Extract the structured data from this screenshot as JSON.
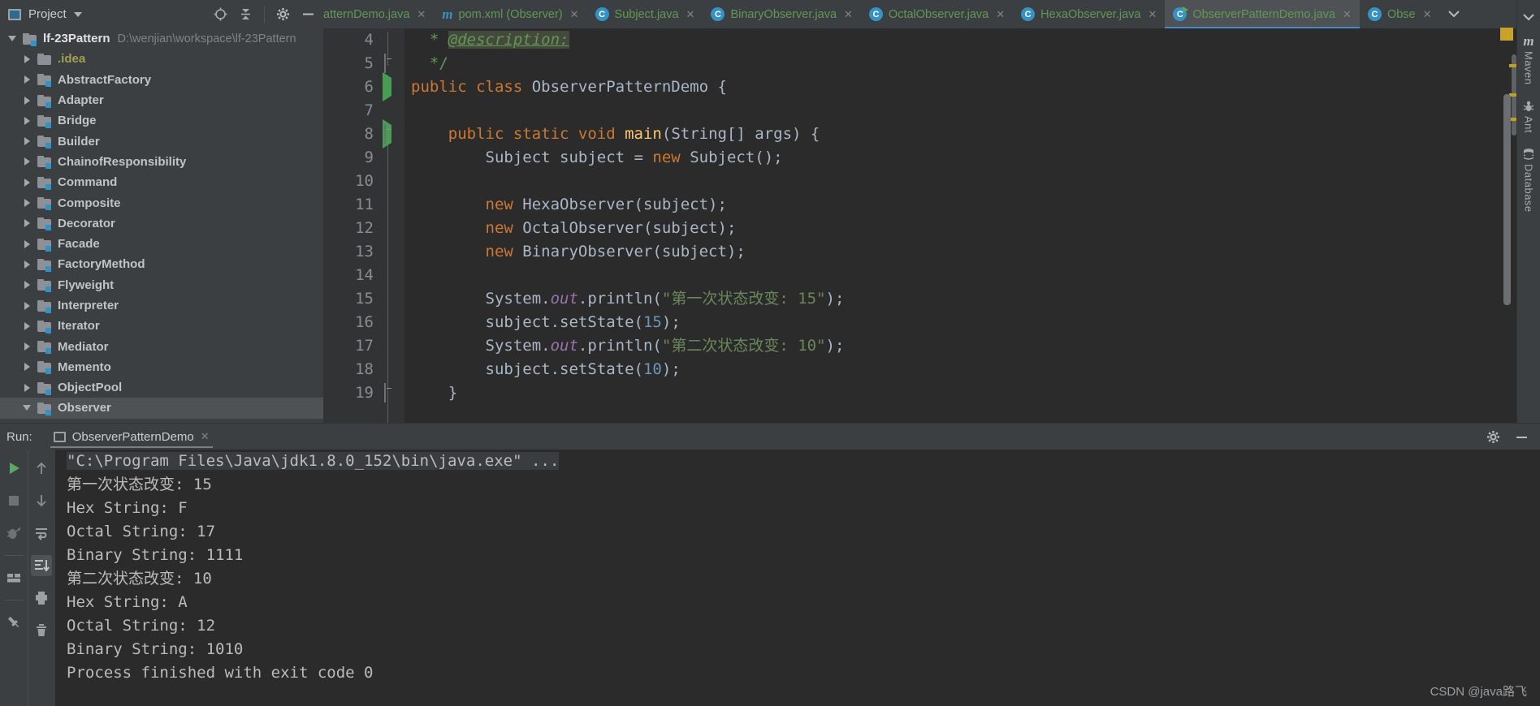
{
  "project_panel": {
    "title": "Project",
    "icons": [
      "locate-icon",
      "collapse-all-icon",
      "settings-icon",
      "hide-icon"
    ],
    "tree": [
      {
        "label": "lf-23Pattern",
        "path": "D:\\wenjian\\workspace\\lf-23Pattern",
        "expanded": true,
        "depth": 0,
        "kind": "root"
      },
      {
        "label": ".idea",
        "path": "",
        "expanded": false,
        "depth": 1,
        "kind": "idea"
      },
      {
        "label": "AbstractFactory",
        "path": "",
        "expanded": false,
        "depth": 1,
        "kind": "module"
      },
      {
        "label": "Adapter",
        "path": "",
        "expanded": false,
        "depth": 1,
        "kind": "module"
      },
      {
        "label": "Bridge",
        "path": "",
        "expanded": false,
        "depth": 1,
        "kind": "module"
      },
      {
        "label": "Builder",
        "path": "",
        "expanded": false,
        "depth": 1,
        "kind": "module"
      },
      {
        "label": "ChainofResponsibility",
        "path": "",
        "expanded": false,
        "depth": 1,
        "kind": "module"
      },
      {
        "label": "Command",
        "path": "",
        "expanded": false,
        "depth": 1,
        "kind": "module"
      },
      {
        "label": "Composite",
        "path": "",
        "expanded": false,
        "depth": 1,
        "kind": "module"
      },
      {
        "label": "Decorator",
        "path": "",
        "expanded": false,
        "depth": 1,
        "kind": "module"
      },
      {
        "label": "Facade",
        "path": "",
        "expanded": false,
        "depth": 1,
        "kind": "module"
      },
      {
        "label": "FactoryMethod",
        "path": "",
        "expanded": false,
        "depth": 1,
        "kind": "module"
      },
      {
        "label": "Flyweight",
        "path": "",
        "expanded": false,
        "depth": 1,
        "kind": "module"
      },
      {
        "label": "Interpreter",
        "path": "",
        "expanded": false,
        "depth": 1,
        "kind": "module"
      },
      {
        "label": "Iterator",
        "path": "",
        "expanded": false,
        "depth": 1,
        "kind": "module"
      },
      {
        "label": "Mediator",
        "path": "",
        "expanded": false,
        "depth": 1,
        "kind": "module"
      },
      {
        "label": "Memento",
        "path": "",
        "expanded": false,
        "depth": 1,
        "kind": "module"
      },
      {
        "label": "ObjectPool",
        "path": "",
        "expanded": false,
        "depth": 1,
        "kind": "module"
      },
      {
        "label": "Observer",
        "path": "",
        "expanded": true,
        "depth": 1,
        "kind": "module",
        "selected": true
      }
    ]
  },
  "editor_tabs": [
    {
      "label": "atternDemo.java",
      "icon": "class-icon",
      "truncated": true,
      "active": false
    },
    {
      "label": "pom.xml (Observer)",
      "icon": "maven-icon",
      "truncated": false,
      "active": false
    },
    {
      "label": "Subject.java",
      "icon": "class-icon",
      "truncated": false,
      "active": false
    },
    {
      "label": "BinaryObserver.java",
      "icon": "class-icon",
      "truncated": false,
      "active": false
    },
    {
      "label": "OctalObserver.java",
      "icon": "class-icon",
      "truncated": false,
      "active": false
    },
    {
      "label": "HexaObserver.java",
      "icon": "class-icon",
      "truncated": false,
      "active": false
    },
    {
      "label": "ObserverPatternDemo.java",
      "icon": "runnable-class-icon",
      "truncated": false,
      "active": true
    },
    {
      "label": "Obse",
      "icon": "class-icon",
      "truncated": false,
      "active": false
    }
  ],
  "editor": {
    "first_line_number": 4,
    "lines": [
      {
        "n": 4,
        "gutter": "",
        "fold": false,
        "tokens": [
          {
            "t": "  ",
            "c": "plain"
          },
          {
            "t": "* ",
            "c": "cmt"
          },
          {
            "t": "@description:",
            "c": "cmt-tag"
          }
        ]
      },
      {
        "n": 5,
        "gutter": "",
        "fold": true,
        "tokens": [
          {
            "t": "  ",
            "c": "plain"
          },
          {
            "t": "*/",
            "c": "cmt"
          }
        ]
      },
      {
        "n": 6,
        "gutter": "run",
        "fold": false,
        "tokens": [
          {
            "t": "public class ",
            "c": "kw"
          },
          {
            "t": "ObserverPatternDemo {",
            "c": "cls"
          }
        ]
      },
      {
        "n": 7,
        "gutter": "",
        "fold": false,
        "tokens": []
      },
      {
        "n": 8,
        "gutter": "run",
        "fold": true,
        "tokens": [
          {
            "t": "    ",
            "c": "plain"
          },
          {
            "t": "public static void ",
            "c": "kw"
          },
          {
            "t": "main",
            "c": "meth"
          },
          {
            "t": "(String[] args) {",
            "c": "cls"
          }
        ]
      },
      {
        "n": 9,
        "gutter": "",
        "fold": false,
        "tokens": [
          {
            "t": "        Subject subject = ",
            "c": "cls"
          },
          {
            "t": "new ",
            "c": "kw"
          },
          {
            "t": "Subject();",
            "c": "cls"
          }
        ]
      },
      {
        "n": 10,
        "gutter": "",
        "fold": false,
        "tokens": []
      },
      {
        "n": 11,
        "gutter": "",
        "fold": false,
        "tokens": [
          {
            "t": "        ",
            "c": "plain"
          },
          {
            "t": "new ",
            "c": "kw"
          },
          {
            "t": "HexaObserver(subject)",
            "c": "cls"
          },
          {
            "t": ";",
            "c": "cls"
          }
        ]
      },
      {
        "n": 12,
        "gutter": "",
        "fold": false,
        "tokens": [
          {
            "t": "        ",
            "c": "plain"
          },
          {
            "t": "new ",
            "c": "kw"
          },
          {
            "t": "OctalObserver(subject)",
            "c": "cls"
          },
          {
            "t": ";",
            "c": "cls"
          }
        ]
      },
      {
        "n": 13,
        "gutter": "",
        "fold": false,
        "tokens": [
          {
            "t": "        ",
            "c": "plain"
          },
          {
            "t": "new ",
            "c": "kw"
          },
          {
            "t": "BinaryObserver(subject)",
            "c": "cls"
          },
          {
            "t": ";",
            "c": "cls"
          }
        ]
      },
      {
        "n": 14,
        "gutter": "",
        "fold": false,
        "tokens": []
      },
      {
        "n": 15,
        "gutter": "",
        "fold": false,
        "tokens": [
          {
            "t": "        System.",
            "c": "cls"
          },
          {
            "t": "out",
            "c": "fld"
          },
          {
            "t": ".println(",
            "c": "cls"
          },
          {
            "t": "\"第一次状态改变: 15\"",
            "c": "str"
          },
          {
            "t": ");",
            "c": "cls"
          }
        ]
      },
      {
        "n": 16,
        "gutter": "",
        "fold": false,
        "tokens": [
          {
            "t": "        subject.setState(",
            "c": "cls"
          },
          {
            "t": "15",
            "c": "num"
          },
          {
            "t": ");",
            "c": "cls"
          }
        ]
      },
      {
        "n": 17,
        "gutter": "",
        "fold": false,
        "tokens": [
          {
            "t": "        System.",
            "c": "cls"
          },
          {
            "t": "out",
            "c": "fld"
          },
          {
            "t": ".println(",
            "c": "cls"
          },
          {
            "t": "\"第二次状态改变: 10\"",
            "c": "str"
          },
          {
            "t": ");",
            "c": "cls"
          }
        ]
      },
      {
        "n": 18,
        "gutter": "",
        "fold": false,
        "tokens": [
          {
            "t": "        subject.setState(",
            "c": "cls"
          },
          {
            "t": "10",
            "c": "num"
          },
          {
            "t": ");",
            "c": "cls"
          }
        ]
      },
      {
        "n": 19,
        "gutter": "",
        "fold": true,
        "tokens": [
          {
            "t": "    }",
            "c": "cls"
          }
        ]
      }
    ]
  },
  "right_stripe": [
    {
      "label": "Maven",
      "icon": "maven-icon"
    },
    {
      "label": "Ant",
      "icon": "ant-icon"
    },
    {
      "label": "Database",
      "icon": "database-icon"
    }
  ],
  "run_panel": {
    "title": "Run:",
    "tab_name": "ObserverPatternDemo",
    "toolbar_left": [
      "rerun-icon",
      "stop-icon",
      "debug-icon",
      "layout-icon",
      "pin-icon"
    ],
    "toolbar_right": [
      "up-arrow-icon",
      "down-arrow-icon",
      "soft-wrap-icon",
      "scroll-to-end-icon",
      "print-icon",
      "trash-icon"
    ],
    "header_right": [
      "settings-icon",
      "minimize-icon"
    ],
    "console": [
      {
        "text": "\"C:\\Program Files\\Java\\jdk1.8.0_152\\bin\\java.exe\" ...",
        "highlight": true
      },
      {
        "text": "第一次状态改变: 15",
        "highlight": false
      },
      {
        "text": "Hex String: F",
        "highlight": false
      },
      {
        "text": "Octal String: 17",
        "highlight": false
      },
      {
        "text": "Binary String: 1111",
        "highlight": false
      },
      {
        "text": "第二次状态改变: 10",
        "highlight": false
      },
      {
        "text": "Hex String: A",
        "highlight": false
      },
      {
        "text": "Octal String: 12",
        "highlight": false
      },
      {
        "text": "Binary String: 1010",
        "highlight": false
      },
      {
        "text": "",
        "highlight": false
      },
      {
        "text": "Process finished with exit code 0",
        "highlight": false
      }
    ]
  },
  "watermark": "CSDN @java路飞",
  "colors": {
    "accent_blue": "#3592c4",
    "tab_underline": "#4a88c7",
    "string_green": "#6a8759",
    "keyword_orange": "#cc7832",
    "number_blue": "#6897bb",
    "panel_bg": "#3c3f41",
    "editor_bg": "#2b2b2b"
  }
}
